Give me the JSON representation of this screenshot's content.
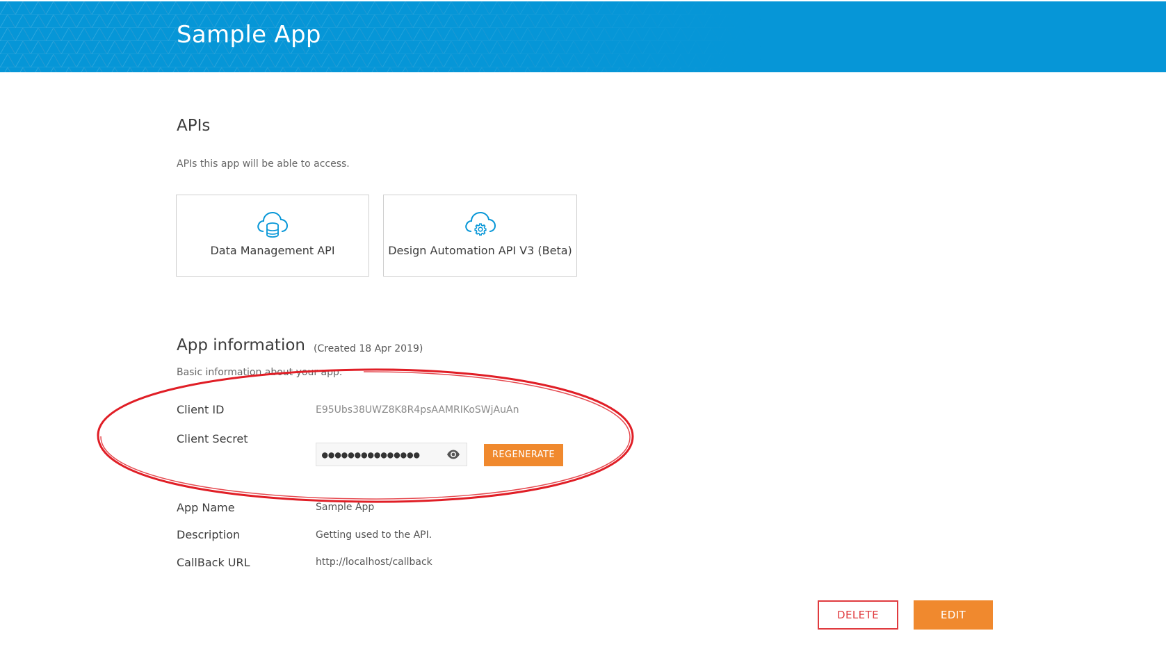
{
  "header": {
    "title": "Sample App",
    "background_color": "#0696d7"
  },
  "apis_section": {
    "title": "APIs",
    "subtitle": "APIs this app will be able to access.",
    "cards": [
      {
        "label": "Data Management API",
        "icon": "cloud-database-icon"
      },
      {
        "label": "Design Automation API V3 (Beta)",
        "icon": "cloud-gear-icon"
      }
    ]
  },
  "app_info": {
    "title": "App information",
    "created": "(Created 18 Apr 2019)",
    "subtitle": "Basic information about your app.",
    "client_id": {
      "label": "Client ID",
      "value": "E95Ubs38UWZ8K8R4psAAMRIKoSWjAuAn"
    },
    "client_secret": {
      "label": "Client Secret",
      "value": "●●●●●●●●●●●●●●●",
      "visibility_icon": "eye-icon"
    },
    "regenerate_label": "REGENERATE",
    "app_name": {
      "label": "App Name",
      "value": "Sample App"
    },
    "description": {
      "label": "Description",
      "value": "Getting used to the API."
    },
    "callback_url": {
      "label": "CallBack URL",
      "value": "http://localhost/callback"
    }
  },
  "actions": {
    "delete_label": "DELETE",
    "edit_label": "EDIT"
  },
  "colors": {
    "accent_orange": "#f0892e",
    "danger_red": "#e03a3e",
    "annotation_red": "#e01e26",
    "icon_blue": "#0696d7"
  }
}
